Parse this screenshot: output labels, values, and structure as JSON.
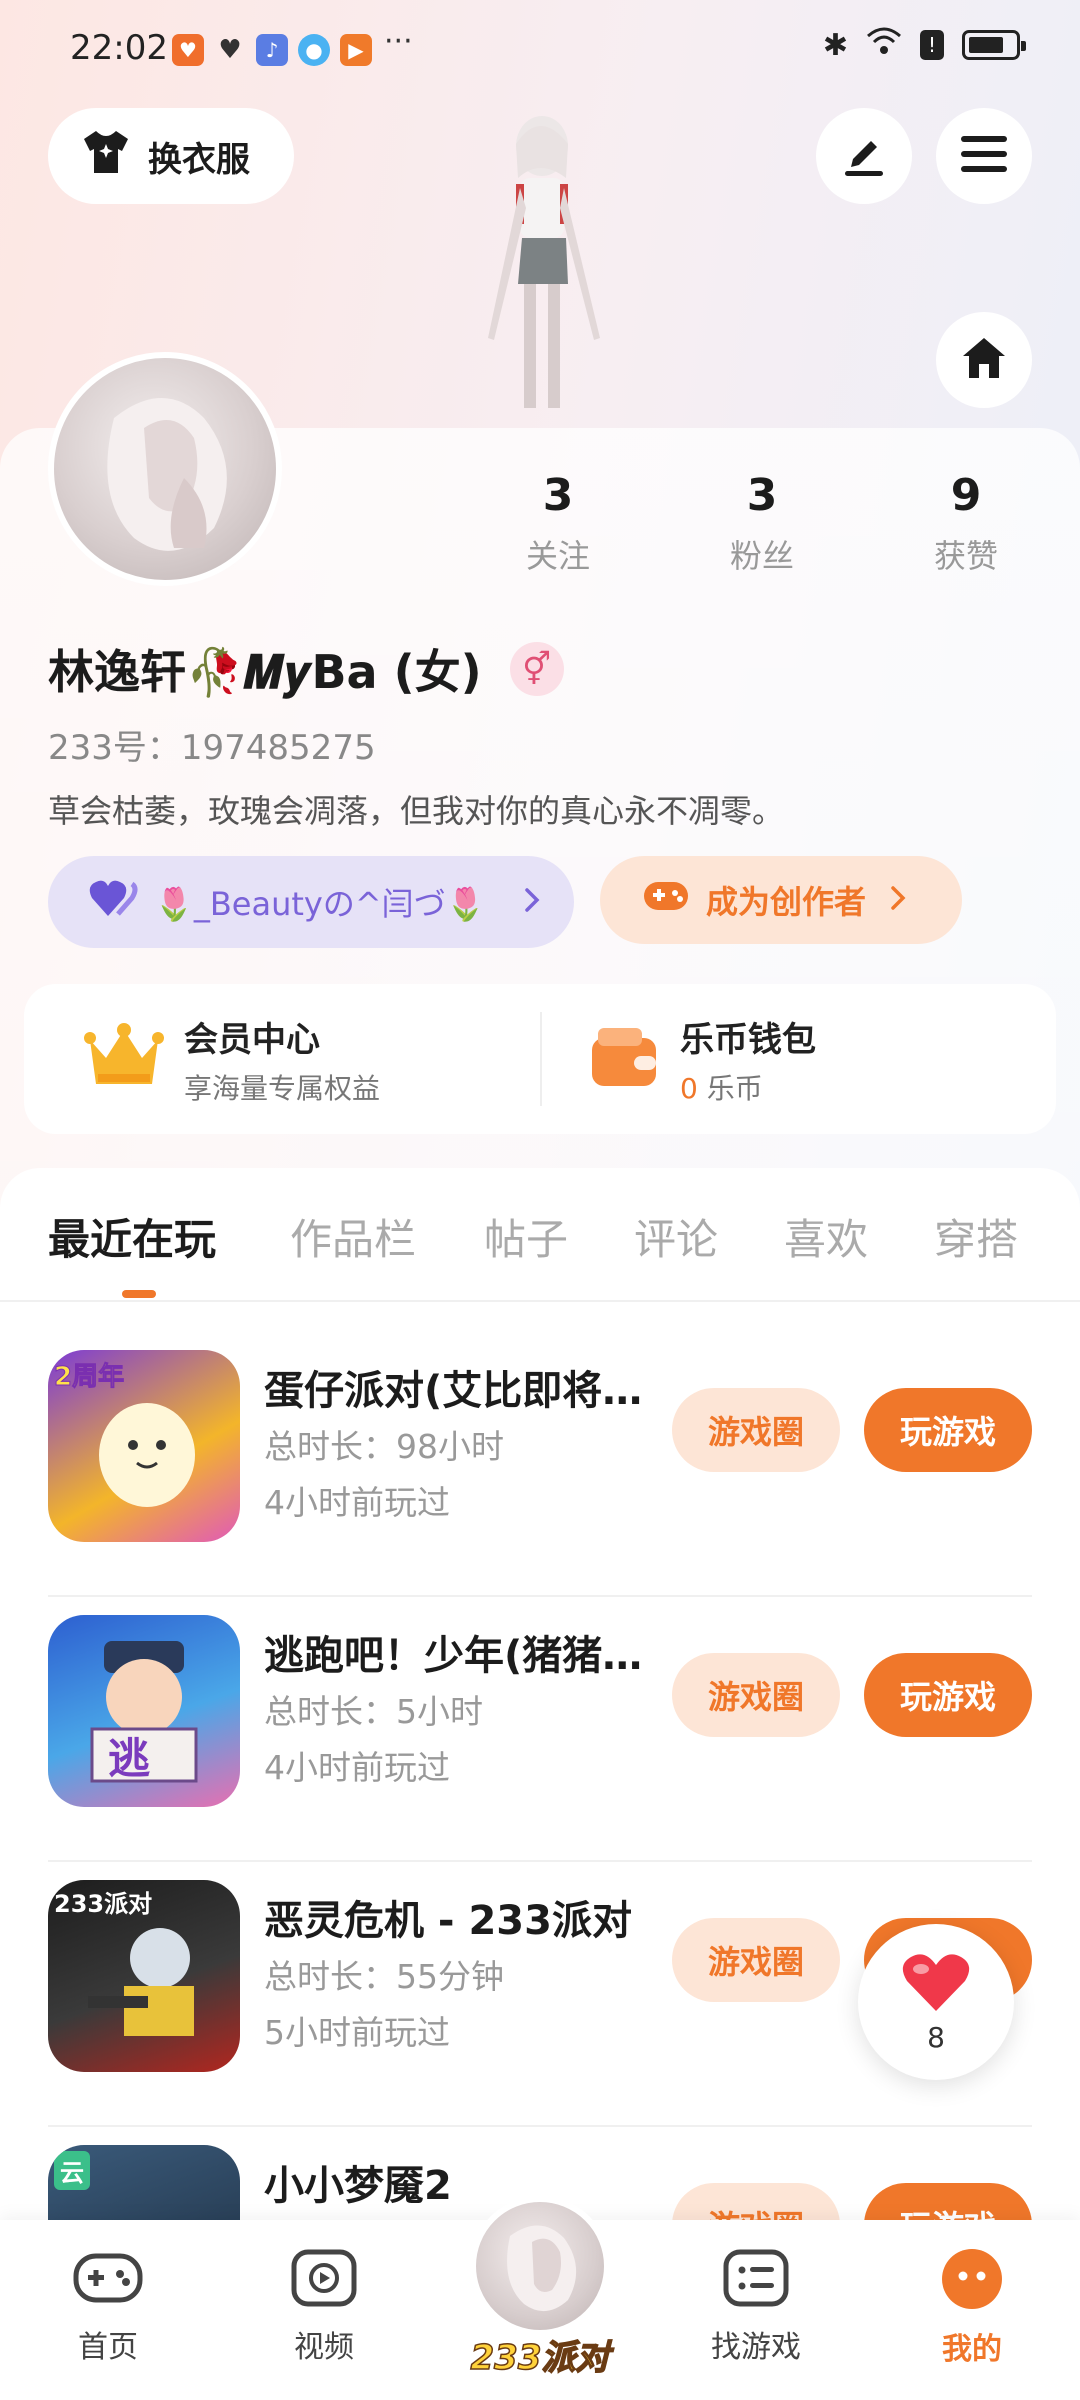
{
  "status_bar": {
    "time": "22:02",
    "more": "···"
  },
  "top_bar": {
    "outfit_button": "换衣服",
    "edit_icon": "edit-icon",
    "menu_icon": "menu-icon",
    "home_icon": "home-icon"
  },
  "profile": {
    "stats": [
      {
        "value": "3",
        "label": "关注"
      },
      {
        "value": "3",
        "label": "粉丝"
      },
      {
        "value": "9",
        "label": "获赞"
      }
    ],
    "nickname": "林逸轩🥀𝑴𝒚Ba (女)",
    "gender_symbol": "⚥",
    "uid": "233号：197485275",
    "bio": "草会枯萎，玫瑰会凋落，但我对你的真心永不凋零。",
    "guild_label": "🌷_Beautyの^闫づ🌷",
    "creator_label": "成为创作者"
  },
  "member_center": {
    "title": "会员中心",
    "subtitle": "享海量专属权益"
  },
  "wallet": {
    "title": "乐币钱包",
    "balance": "0",
    "unit": "乐币"
  },
  "tabs": [
    "最近在玩",
    "作品栏",
    "帖子",
    "评论",
    "喜欢",
    "穿搭"
  ],
  "games": [
    {
      "name": "蛋仔派对(艾比即将…",
      "duration": "总时长：98小时",
      "last_played": "4小时前玩过",
      "icon_text": "2周年"
    },
    {
      "name": "逃跑吧！少年(猪猪…",
      "duration": "总时长：5小时",
      "last_played": "4小时前玩过",
      "icon_text": "逃"
    },
    {
      "name": "恶灵危机 - 233派对",
      "duration": "总时长：55分钟",
      "last_played": "5小时前玩过",
      "icon_text": "233派对"
    },
    {
      "name": "小小梦魇2",
      "duration": "",
      "last_played": "",
      "icon_text": "云"
    }
  ],
  "game_buttons": {
    "circle": "游戏圈",
    "play": "玩游戏"
  },
  "like_bubble": {
    "count": "8"
  },
  "bottom_nav": {
    "items": [
      "首页",
      "视频",
      "找游戏",
      "我的"
    ],
    "center_label": "233派对"
  },
  "colors": {
    "accent": "#f0772a",
    "accent_light": "#fde5d6",
    "guild": "#7a63d8"
  }
}
